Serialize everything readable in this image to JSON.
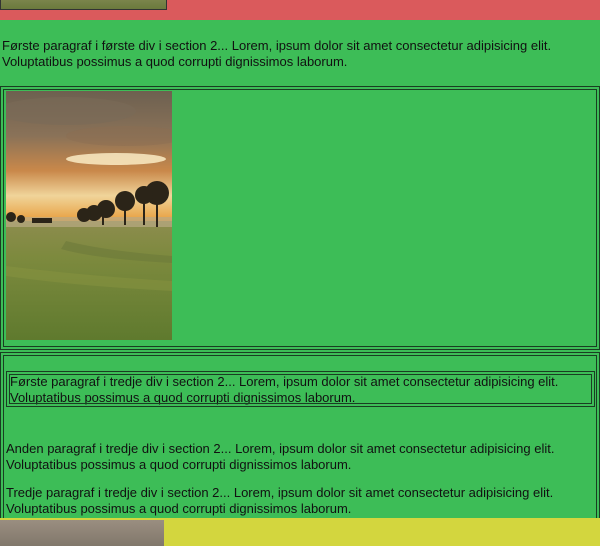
{
  "section2": {
    "first_div": {
      "paragraph": "Første paragraf i første div i section 2... Lorem, ipsum dolor sit amet consectetur adipisicing elit. Voluptatibus possimus a quod corrupti dignissimos laborum."
    },
    "third_div": {
      "paragraphs": [
        "Første paragraf i tredje div i section 2... Lorem, ipsum dolor sit amet consectetur adipisicing elit. Voluptatibus possimus a quod corrupti dignissimos laborum.",
        "Anden paragraf i tredje div i section 2... Lorem, ipsum dolor sit amet consectetur adipisicing elit. Voluptatibus possimus a quod corrupti dignissimos laborum.",
        "Tredje paragraf i tredje div i section 2... Lorem, ipsum dolor sit amet consectetur adipisicing elit. Voluptatibus possimus a quod corrupti dignissimos laborum."
      ]
    }
  },
  "colors": {
    "top_band": "#da5a5c",
    "section_bg": "#3dbd57",
    "bottom_band": "#d3d63e",
    "border": "#1a3d22"
  },
  "images": {
    "main": "sunset-landscape-image"
  }
}
